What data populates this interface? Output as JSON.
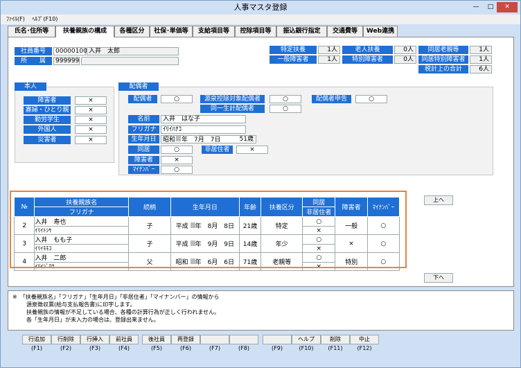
{
  "title": "人事マスタ登録",
  "menu": [
    "ﾌｧｲﾙ(F)",
    "ﾍﾙﾌﾟ(F10)"
  ],
  "tabs": [
    "氏名･住所等",
    "扶養親族の構成",
    "各種区分",
    "社保･単価等",
    "支給項目等",
    "控除項目等",
    "振込銀行指定",
    "交通費等",
    "Web連携"
  ],
  "employee": {
    "no_label": "社員番号",
    "no": "00000100",
    "name": "入井　太郎",
    "dept_label": "所　　属",
    "dept": "999999"
  },
  "summary": {
    "tokutei_label": "特定扶養",
    "tokutei": "1人",
    "rojin_label": "老人扶養",
    "rojin": "0人",
    "dokyo_label": "同居老親等",
    "dokyo": "1人",
    "ippan_label": "一般障害者",
    "ippan": "1人",
    "tokubetsu_label": "特別障害者",
    "tokubetsu": "0人",
    "dokyo_toku_label": "同居特別障害者",
    "dokyo_toku": "1人",
    "total_label": "税計上の合計",
    "total": "6人"
  },
  "self": {
    "title": "本人",
    "rows": [
      {
        "label": "障害者",
        "v": "×"
      },
      {
        "label": "寡婦・ひとり親",
        "v": "×"
      },
      {
        "label": "勤労学生",
        "v": "×"
      },
      {
        "label": "外国人",
        "v": "×"
      },
      {
        "label": "災害者",
        "v": "×"
      }
    ]
  },
  "spouse": {
    "title": "配偶者",
    "haigu_label": "配偶者",
    "haigu": "○",
    "gensen_label": "源泉控除対象配偶者",
    "gensen": "○",
    "shinkoku_label": "配偶者申告",
    "shinkoku": "○",
    "doitsu_label": "同一生計配偶者",
    "doitsu": "○",
    "name_label": "名前",
    "name": "入井　はな子",
    "kana_label": "フリガナ",
    "kana": "ｲﾘｲﾊﾅｺ",
    "dob_label": "生年月日",
    "dob_era": "昭和",
    "dob_rest": "年　7月　7日",
    "age": "51歳",
    "dokyo_label": "同居",
    "dokyo": "○",
    "hikyo_label": "非居住者",
    "hikyo": "×",
    "shogai_label": "障害者",
    "shogai": "×",
    "mynum_label": "ﾏｲﾅﾝﾊﾞｰ",
    "mynum": "○"
  },
  "grid": {
    "headers": {
      "no": "№",
      "name": "扶養親族名",
      "kana": "フリガナ",
      "rel": "続柄",
      "dob": "生年月日",
      "age": "年齢",
      "kubun": "扶養区分",
      "dokyo": "同居",
      "hikyo": "非居住者",
      "shogai": "障害者",
      "mynum": "ﾏｲﾅﾝﾊﾞｰ"
    },
    "rows": [
      {
        "no": "2",
        "name": "入井　寿也",
        "kana": "ｲﾘｲﾄｼﾔ",
        "rel": "子",
        "era": "平成",
        "date": "年　8月　8日",
        "age": "21歳",
        "kubun": "特定",
        "dokyo": "○",
        "hikyo": "×",
        "shogai": "一般",
        "mynum": "○"
      },
      {
        "no": "3",
        "name": "入井　もも子",
        "kana": "ｲﾘｲﾓﾓｺ",
        "rel": "子",
        "era": "平成",
        "date": "年　9月　9日",
        "age": "14歳",
        "kubun": "年少",
        "dokyo": "○",
        "hikyo": "×",
        "shogai": "×",
        "mynum": "○"
      },
      {
        "no": "4",
        "name": "入井　二郎",
        "kana": "ｲﾘｲｼﾞﾛｳ",
        "rel": "父",
        "era": "昭和",
        "date": "年　6月　6日",
        "age": "71歳",
        "kubun": "老親等",
        "dokyo": "○",
        "hikyo": "×",
        "shogai": "特別",
        "mynum": "○"
      }
    ]
  },
  "up": "上へ",
  "down": "下へ",
  "notes": [
    "※　「扶養親族名」「フリガナ」「生年月日」「非居住者」「マイナンバー」の情報から",
    "源泉徴収票(給与支払報告書)に印字します。",
    "扶養親族の情報が不足している場合、各種の計算行為が正しく行われません。",
    "各「生年月日」が未入力の場合は、登録出来ません。"
  ],
  "fkeys": [
    {
      "label": "行追加",
      "key": "(F1)"
    },
    {
      "label": "行削除",
      "key": "(F2)"
    },
    {
      "label": "行挿入",
      "key": "(F3)"
    },
    {
      "label": "前社員",
      "key": "(F4)"
    },
    {
      "label": "後社員",
      "key": "(F5)"
    },
    {
      "label": "再登録",
      "key": "(F6)"
    },
    {
      "label": "",
      "key": "(F7)"
    },
    {
      "label": "",
      "key": "(F8)"
    },
    {
      "label": "",
      "key": "(F9)"
    },
    {
      "label": "ヘルプ",
      "key": "(F10)"
    },
    {
      "label": "削除",
      "key": "(F11)"
    },
    {
      "label": "中止",
      "key": "(F12)"
    }
  ]
}
